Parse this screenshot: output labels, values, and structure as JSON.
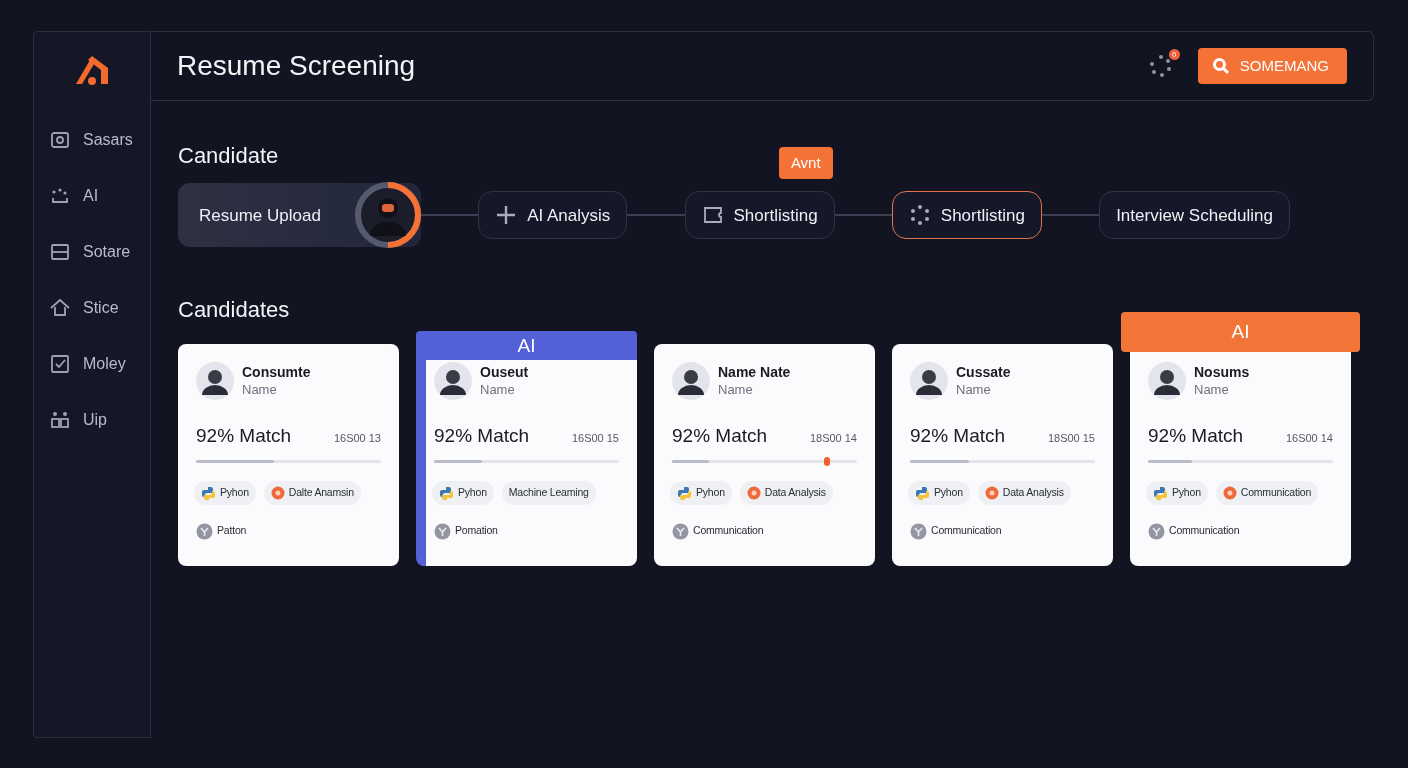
{
  "sidebar": {
    "items": [
      {
        "label": "Sasars",
        "kind": "frame"
      },
      {
        "label": "AI",
        "kind": "dots"
      },
      {
        "label": "Sotare",
        "kind": "panel"
      },
      {
        "label": "Stice",
        "kind": "home"
      },
      {
        "label": "Moley",
        "kind": "check"
      },
      {
        "label": "Uip",
        "kind": "grid"
      }
    ]
  },
  "header": {
    "title": "Resume Screening",
    "notification_badge": "0",
    "button": "SOMEMANG"
  },
  "pipeline": {
    "title": "Candidate",
    "steps": [
      {
        "label": "Resume Upload",
        "kind": "upload",
        "selected": false,
        "level": 0.5
      },
      {
        "label": "AI Analysis",
        "kind": "plus",
        "selected": false
      },
      {
        "label": "Shortlisting",
        "kind": "ticket",
        "selected": false,
        "tooltip": "Avnt"
      },
      {
        "label": "Shortlisting",
        "kind": "spinner",
        "selected": true
      },
      {
        "label": "Interview Scheduling",
        "kind": "plain",
        "selected": false
      }
    ]
  },
  "candidates": {
    "title": "Candidates",
    "cards": [
      {
        "name": "Consumte",
        "subtitle": "Name",
        "match": "92% Match",
        "code": "16S00 13",
        "level": 0.42,
        "skills": [
          {
            "label": "Pyhon",
            "kind": "python"
          },
          {
            "label": "Dalte Anamsin",
            "kind": "dot"
          },
          {
            "label": "Patton",
            "kind": "emblem"
          }
        ]
      },
      {
        "name": "Ouseut",
        "subtitle": "Name",
        "match": "92% Match",
        "code": "16S00 15",
        "level": 0.26,
        "banner": {
          "label": "AI",
          "color": "#5460d8"
        },
        "skills": [
          {
            "label": "Pyhon",
            "kind": "python"
          },
          {
            "label": "Machine Leaming",
            "kind": "text"
          },
          {
            "label": "Pomation",
            "kind": "emblem"
          }
        ]
      },
      {
        "name": "Name Nate",
        "subtitle": "Name",
        "match": "92% Match",
        "code": "18S00 14",
        "level": 0.2,
        "marker": {
          "level": 0.84
        },
        "skills": [
          {
            "label": "Pyhon",
            "kind": "python"
          },
          {
            "label": "Data Analysis",
            "kind": "dot"
          },
          {
            "label": "Communication",
            "kind": "emblem"
          }
        ]
      },
      {
        "name": "Cussate",
        "subtitle": "Name",
        "match": "92% Match",
        "code": "18S00 15",
        "level": 0.32,
        "skills": [
          {
            "label": "Pyhon",
            "kind": "python"
          },
          {
            "label": "Data Analysis",
            "kind": "dot"
          },
          {
            "label": "Communication",
            "kind": "emblem"
          }
        ]
      },
      {
        "name": "Nosums",
        "subtitle": "Name",
        "match": "92% Match",
        "code": "16S00 14",
        "level": 0.24,
        "banner": {
          "label": "AI",
          "color": "#f27436"
        },
        "skills": [
          {
            "label": "Pyhon",
            "kind": "python"
          },
          {
            "label": "Communication",
            "kind": "dot"
          },
          {
            "label": "Communication",
            "kind": "emblem"
          }
        ]
      }
    ]
  }
}
